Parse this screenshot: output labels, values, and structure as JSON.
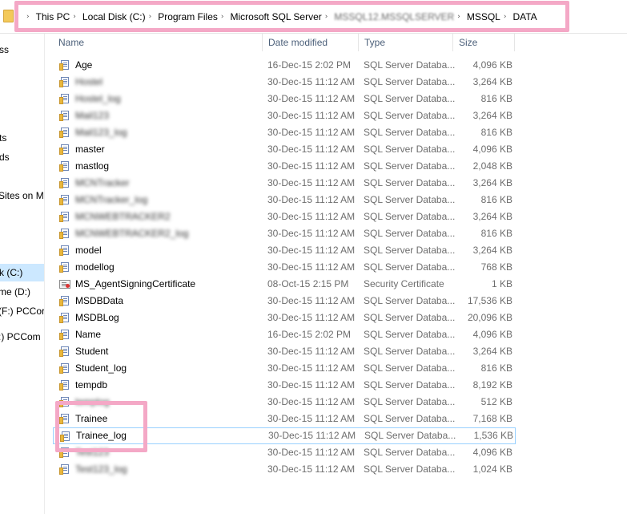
{
  "breadcrumbs": [
    {
      "label": "This PC",
      "blurred": false
    },
    {
      "label": "Local Disk (C:)",
      "blurred": false
    },
    {
      "label": "Program Files",
      "blurred": false
    },
    {
      "label": "Microsoft SQL Server",
      "blurred": false
    },
    {
      "label": "MSSQL12.MSSQLSERVER",
      "blurred": true
    },
    {
      "label": "MSSQL",
      "blurred": false
    },
    {
      "label": "DATA",
      "blurred": false
    }
  ],
  "nav": {
    "items": [
      {
        "label": "ss"
      },
      {
        "label": "ts"
      },
      {
        "label": "ds"
      },
      {
        "label": "Sites on M"
      },
      {
        "label": "k (C:)"
      },
      {
        "label": "me (D:)"
      },
      {
        "label": "(F:) PCCor"
      },
      {
        "label": ":) PCCom"
      }
    ]
  },
  "columns": {
    "name": "Name",
    "date": "Date modified",
    "type": "Type",
    "size": "Size"
  },
  "files": [
    {
      "name": "Age",
      "date": "16-Dec-15 2:02 PM",
      "type": "SQL Server Databa...",
      "size": "4,096 KB",
      "blurred": false,
      "icon": "database-file-icon"
    },
    {
      "name": "Hostel",
      "date": "30-Dec-15 11:12 AM",
      "type": "SQL Server Databa...",
      "size": "3,264 KB",
      "blurred": true,
      "icon": "database-file-icon"
    },
    {
      "name": "Hostel_log",
      "date": "30-Dec-15 11:12 AM",
      "type": "SQL Server Databa...",
      "size": "816 KB",
      "blurred": true,
      "icon": "database-file-icon"
    },
    {
      "name": "Mail123",
      "date": "30-Dec-15 11:12 AM",
      "type": "SQL Server Databa...",
      "size": "3,264 KB",
      "blurred": true,
      "icon": "database-file-icon"
    },
    {
      "name": "Mail123_log",
      "date": "30-Dec-15 11:12 AM",
      "type": "SQL Server Databa...",
      "size": "816 KB",
      "blurred": true,
      "icon": "database-file-icon"
    },
    {
      "name": "master",
      "date": "30-Dec-15 11:12 AM",
      "type": "SQL Server Databa...",
      "size": "4,096 KB",
      "blurred": false,
      "icon": "database-file-icon"
    },
    {
      "name": "mastlog",
      "date": "30-Dec-15 11:12 AM",
      "type": "SQL Server Databa...",
      "size": "2,048 KB",
      "blurred": false,
      "icon": "database-file-icon"
    },
    {
      "name": "MCNTracker",
      "date": "30-Dec-15 11:12 AM",
      "type": "SQL Server Databa...",
      "size": "3,264 KB",
      "blurred": true,
      "icon": "database-file-icon"
    },
    {
      "name": "MCNTracker_log",
      "date": "30-Dec-15 11:12 AM",
      "type": "SQL Server Databa...",
      "size": "816 KB",
      "blurred": true,
      "icon": "database-file-icon"
    },
    {
      "name": "MCNWEBTRACKER2",
      "date": "30-Dec-15 11:12 AM",
      "type": "SQL Server Databa...",
      "size": "3,264 KB",
      "blurred": true,
      "icon": "database-file-icon"
    },
    {
      "name": "MCNWEBTRACKER2_log",
      "date": "30-Dec-15 11:12 AM",
      "type": "SQL Server Databa...",
      "size": "816 KB",
      "blurred": true,
      "icon": "database-file-icon"
    },
    {
      "name": "model",
      "date": "30-Dec-15 11:12 AM",
      "type": "SQL Server Databa...",
      "size": "3,264 KB",
      "blurred": false,
      "icon": "database-file-icon"
    },
    {
      "name": "modellog",
      "date": "30-Dec-15 11:12 AM",
      "type": "SQL Server Databa...",
      "size": "768 KB",
      "blurred": false,
      "icon": "database-file-icon"
    },
    {
      "name": "MS_AgentSigningCertificate",
      "date": "08-Oct-15 2:15 PM",
      "type": "Security Certificate",
      "size": "1 KB",
      "blurred": false,
      "icon": "certificate-icon"
    },
    {
      "name": "MSDBData",
      "date": "30-Dec-15 11:12 AM",
      "type": "SQL Server Databa...",
      "size": "17,536 KB",
      "blurred": false,
      "icon": "database-file-icon"
    },
    {
      "name": "MSDBLog",
      "date": "30-Dec-15 11:12 AM",
      "type": "SQL Server Databa...",
      "size": "20,096 KB",
      "blurred": false,
      "icon": "database-file-icon"
    },
    {
      "name": "Name",
      "date": "16-Dec-15 2:02 PM",
      "type": "SQL Server Databa...",
      "size": "4,096 KB",
      "blurred": false,
      "icon": "database-file-icon"
    },
    {
      "name": "Student",
      "date": "30-Dec-15 11:12 AM",
      "type": "SQL Server Databa...",
      "size": "3,264 KB",
      "blurred": false,
      "icon": "database-file-icon"
    },
    {
      "name": "Student_log",
      "date": "30-Dec-15 11:12 AM",
      "type": "SQL Server Databa...",
      "size": "816 KB",
      "blurred": false,
      "icon": "database-file-icon"
    },
    {
      "name": "tempdb",
      "date": "30-Dec-15 11:12 AM",
      "type": "SQL Server Databa...",
      "size": "8,192 KB",
      "blurred": false,
      "icon": "database-file-icon"
    },
    {
      "name": "templog",
      "date": "30-Dec-15 11:12 AM",
      "type": "SQL Server Databa...",
      "size": "512 KB",
      "blurred": true,
      "icon": "database-file-icon"
    },
    {
      "name": "Trainee",
      "date": "30-Dec-15 11:12 AM",
      "type": "SQL Server Databa...",
      "size": "7,168 KB",
      "blurred": false,
      "icon": "database-file-icon"
    },
    {
      "name": "Trainee_log",
      "date": "30-Dec-15 11:12 AM",
      "type": "SQL Server Databa...",
      "size": "1,536 KB",
      "blurred": false,
      "icon": "database-file-icon",
      "focused": true
    },
    {
      "name": "Test123",
      "date": "30-Dec-15 11:12 AM",
      "type": "SQL Server Databa...",
      "size": "4,096 KB",
      "blurred": true,
      "icon": "database-file-icon"
    },
    {
      "name": "Test123_log",
      "date": "30-Dec-15 11:12 AM",
      "type": "SQL Server Databa...",
      "size": "1,024 KB",
      "blurred": true,
      "icon": "database-file-icon"
    }
  ],
  "highlight_color": "#f4a8c6"
}
